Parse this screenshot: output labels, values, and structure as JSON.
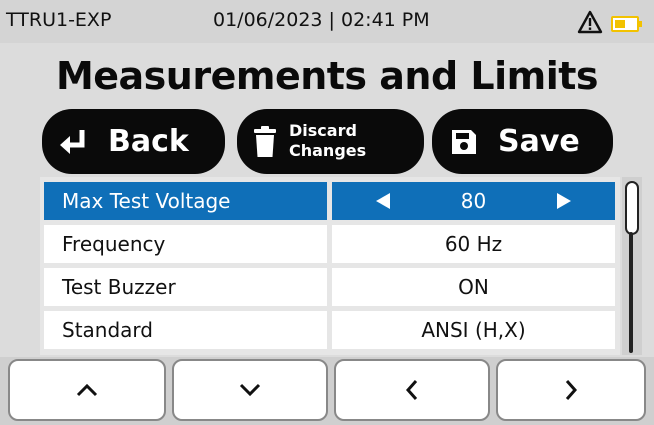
{
  "status_bar": {
    "device_name": "TTRU1-EXP",
    "datetime": "01/06/2023 | 02:41 PM",
    "warning_icon": "warning-triangle-icon",
    "battery_icon": "battery-icon",
    "battery_level_fraction": 0.5,
    "battery_color": "#f2c200"
  },
  "page": {
    "title": "Measurements and Limits"
  },
  "toolbar": {
    "back_label": "Back",
    "back_icon": "return-arrow-icon",
    "discard_label_line1": "Discard",
    "discard_label_line2": "Changes",
    "discard_icon": "trash-icon",
    "save_label": "Save",
    "save_icon": "floppy-disk-icon"
  },
  "settings": [
    {
      "name": "Max Test Voltage",
      "value": "80",
      "selected": true
    },
    {
      "name": "Frequency",
      "value": "60 Hz",
      "selected": false
    },
    {
      "name": "Test Buzzer",
      "value": "ON",
      "selected": false
    },
    {
      "name": "Standard",
      "value": "ANSI (H,X)",
      "selected": false
    }
  ],
  "colors": {
    "selection": "#0f6fb8",
    "button_bg": "#0a0a0a"
  },
  "navigation": {
    "up_icon": "chevron-up-icon",
    "down_icon": "chevron-down-icon",
    "left_icon": "chevron-left-icon",
    "right_icon": "chevron-right-icon"
  }
}
